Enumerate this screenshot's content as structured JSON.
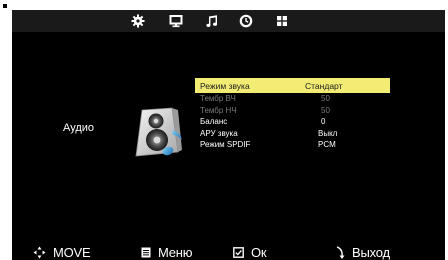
{
  "section": {
    "title": "Аудио"
  },
  "tabs": [
    {
      "name": "picture",
      "icon": "gear-icon"
    },
    {
      "name": "screen",
      "icon": "monitor-icon"
    },
    {
      "name": "audio",
      "icon": "music-note-icon"
    },
    {
      "name": "time",
      "icon": "clock-icon"
    },
    {
      "name": "setup",
      "icon": "grid-icon"
    }
  ],
  "menu": {
    "items": [
      {
        "label": "Режим звука",
        "value": "Стандарт",
        "state": "selected"
      },
      {
        "label": "Тембр ВЧ",
        "value": "50",
        "state": "disabled"
      },
      {
        "label": "Тембр НЧ",
        "value": "50",
        "state": "disabled"
      },
      {
        "label": "Баланс",
        "value": "0",
        "state": "normal"
      },
      {
        "label": "АРУ звука",
        "value": "Выкл",
        "state": "normal"
      },
      {
        "label": "Режим SPDIF",
        "value": "PCM",
        "state": "normal"
      }
    ]
  },
  "footer": {
    "move": "MOVE",
    "menu": "Меню",
    "ok": "Ок",
    "exit": "Выход"
  },
  "colors": {
    "background": "#000000",
    "highlight": "#f2ec74",
    "disabled_text": "#7a7a7a",
    "text": "#ffffff"
  }
}
